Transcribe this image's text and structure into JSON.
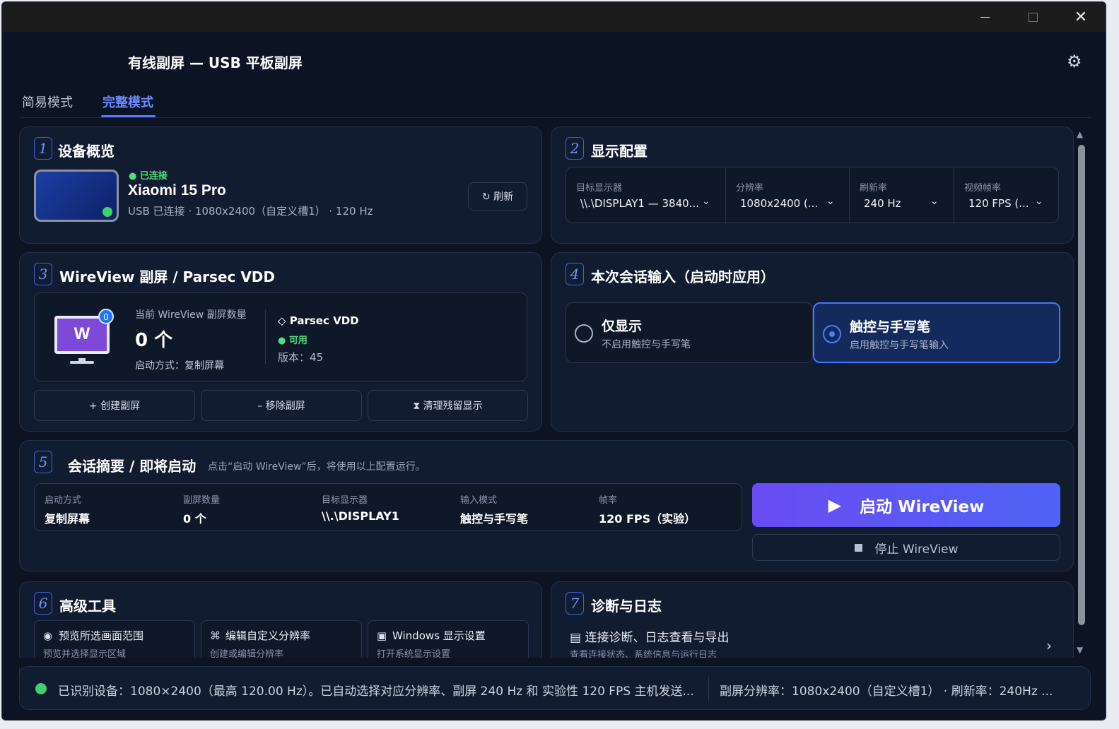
{
  "window": {
    "minimize": "—",
    "close": "✕"
  },
  "header": {
    "title": "有线副屏 — USB 平板副屏",
    "settings_icon": "gear-icon"
  },
  "tabs": [
    {
      "label": "简易模式",
      "active": false
    },
    {
      "label": "完整模式",
      "active": true
    }
  ],
  "device": {
    "num": "1",
    "title": "设备概览",
    "status": "● 已连接",
    "name": "Xiaomi 15 Pro",
    "info": "USB 已连接 · 1080x2400（自定义槽1） · 120 Hz",
    "refresh_label": "↻  刷新"
  },
  "display": {
    "num": "2",
    "title": "显示配置",
    "fields": [
      {
        "label": "目标显示器",
        "value": "\\\\.\\DISPLAY1 — 3840..."
      },
      {
        "label": "分辨率",
        "value": "1080x2400  (..."
      },
      {
        "label": "刷新率",
        "value": "240 Hz"
      },
      {
        "label": "视频帧率",
        "value": "120 FPS  (..."
      }
    ]
  },
  "wireview": {
    "num": "3",
    "title": "WireView 副屏 / Parsec VDD",
    "monitor_letter": "W",
    "badge": "0",
    "count_label": "当前 WireView 副屏数量",
    "count": "0 个",
    "mode": "启动方式：复制屏幕",
    "parsec_title": "◇  Parsec VDD",
    "parsec_status": "● 可用",
    "parsec_version": "版本：45",
    "buttons": [
      "+ 创建副屏",
      "– 移除副屏",
      "⧗ 清理残留显示"
    ]
  },
  "input": {
    "num": "4",
    "title": "本次会话输入（启动时应用）",
    "options": [
      {
        "title": "仅显示",
        "desc": "不启用触控与手写笔",
        "selected": false
      },
      {
        "title": "触控与手写笔",
        "desc": "启用触控与手写笔输入",
        "selected": true
      }
    ]
  },
  "summary": {
    "num": "5",
    "title": "会话摘要 / 即将启动",
    "hint": "点击“启动 WireView”后，将使用以上配置运行。",
    "items": [
      {
        "label": "启动方式",
        "value": "复制屏幕"
      },
      {
        "label": "副屏数量",
        "value": "0 个"
      },
      {
        "label": "目标显示器",
        "value": "\\\\.\\DISPLAY1"
      },
      {
        "label": "输入模式",
        "value": "触控与手写笔"
      },
      {
        "label": "帧率",
        "value": "120 FPS（实验）"
      }
    ],
    "start_label": "启动 WireView",
    "stop_label": "停止 WireView"
  },
  "tools": {
    "num": "6",
    "title": "高级工具",
    "items": [
      {
        "icon": "◉",
        "title": "预览所选画面范围",
        "desc": "预览并选择显示区域"
      },
      {
        "icon": "⌘",
        "title": "编辑自定义分辨率",
        "desc": "创建或编辑分辨率"
      },
      {
        "icon": "▣",
        "title": "Windows 显示设置",
        "desc": "打开系统显示设置"
      }
    ]
  },
  "diagnostics": {
    "num": "7",
    "title": "诊断与日志",
    "item_title": "▤  连接诊断、日志查看与导出",
    "item_desc": "查看连接状态、系统信息与运行日志"
  },
  "status_bar": {
    "text": "已识别设备：1080×2400（最高 120.00 Hz）。已自动选择对应分辨率、副屏 240 Hz 和 实验性 120 FPS 主机发送...",
    "right": "副屏分辨率：1080x2400（自定义槽1）   ·   刷新率：240Hz   ..."
  },
  "colors": {
    "accent": "#5a78ff",
    "success": "#3fd16a",
    "start_button": "#6a4cf2",
    "background": "#0c1424",
    "card": "#121c30"
  }
}
